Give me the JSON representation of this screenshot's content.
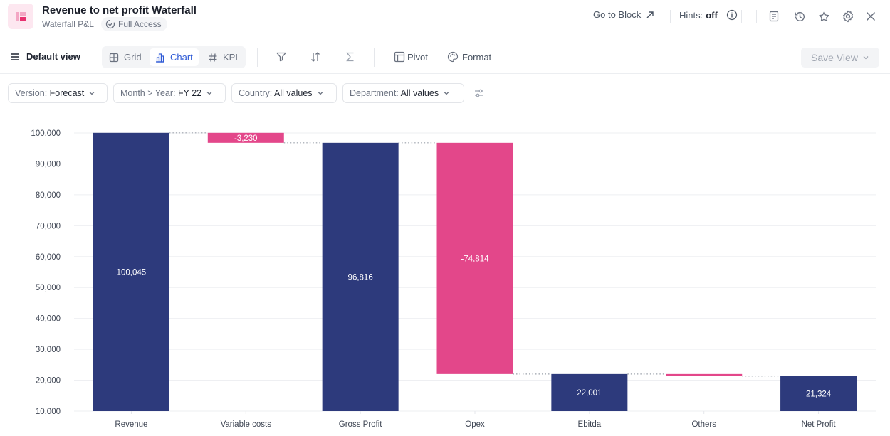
{
  "header": {
    "title": "Revenue to net profit Waterfall",
    "subtitle": "Waterfall P&L",
    "access_label": "Full Access",
    "go_to_block": "Go to Block",
    "hints_label": "Hints:",
    "hints_value": "off"
  },
  "toolbar": {
    "view_label": "Default view",
    "tabs": [
      {
        "label": "Grid",
        "icon": "grid-icon",
        "active": false
      },
      {
        "label": "Chart",
        "icon": "bar-chart-icon",
        "active": true
      },
      {
        "label": "KPI",
        "icon": "hash-icon",
        "active": false
      }
    ],
    "pivot_label": "Pivot",
    "format_label": "Format",
    "save_view_label": "Save View"
  },
  "filters": [
    {
      "label": "Version:",
      "value": "Forecast"
    },
    {
      "label": "Month > Year:",
      "value": "FY 22"
    },
    {
      "label": "Country:",
      "value": "All values"
    },
    {
      "label": "Department:",
      "value": "All values"
    }
  ],
  "colors": {
    "total": "#2d3a7c",
    "negative": "#e3478a"
  },
  "chart_data": {
    "type": "waterfall",
    "title": "",
    "xlabel": "",
    "ylabel": "",
    "ylim": [
      10000,
      100000
    ],
    "yticks": [
      10000,
      20000,
      30000,
      40000,
      50000,
      60000,
      70000,
      80000,
      90000,
      100000
    ],
    "ytick_labels": [
      "10,000",
      "20,000",
      "30,000",
      "40,000",
      "50,000",
      "60,000",
      "70,000",
      "80,000",
      "90,000",
      "100,000"
    ],
    "grid": true,
    "legend": "none",
    "categories": [
      "Revenue",
      "Variable costs",
      "Gross Profit",
      "Opex",
      "Ebitda",
      "Others",
      "Net Profit"
    ],
    "bars": [
      {
        "category": "Revenue",
        "kind": "total",
        "start": 0,
        "end": 100045,
        "label": "100,045"
      },
      {
        "category": "Variable costs",
        "kind": "delta",
        "start": 100045,
        "end": 96816,
        "label": "-3,230"
      },
      {
        "category": "Gross Profit",
        "kind": "total",
        "start": 0,
        "end": 96816,
        "label": "96,816"
      },
      {
        "category": "Opex",
        "kind": "delta",
        "start": 96816,
        "end": 22001,
        "label": "-74,814"
      },
      {
        "category": "Ebitda",
        "kind": "total",
        "start": 0,
        "end": 22001,
        "label": "22,001"
      },
      {
        "category": "Others",
        "kind": "delta",
        "start": 22001,
        "end": 21324,
        "label": ""
      },
      {
        "category": "Net Profit",
        "kind": "total",
        "start": 0,
        "end": 21324,
        "label": "21,324"
      }
    ]
  }
}
